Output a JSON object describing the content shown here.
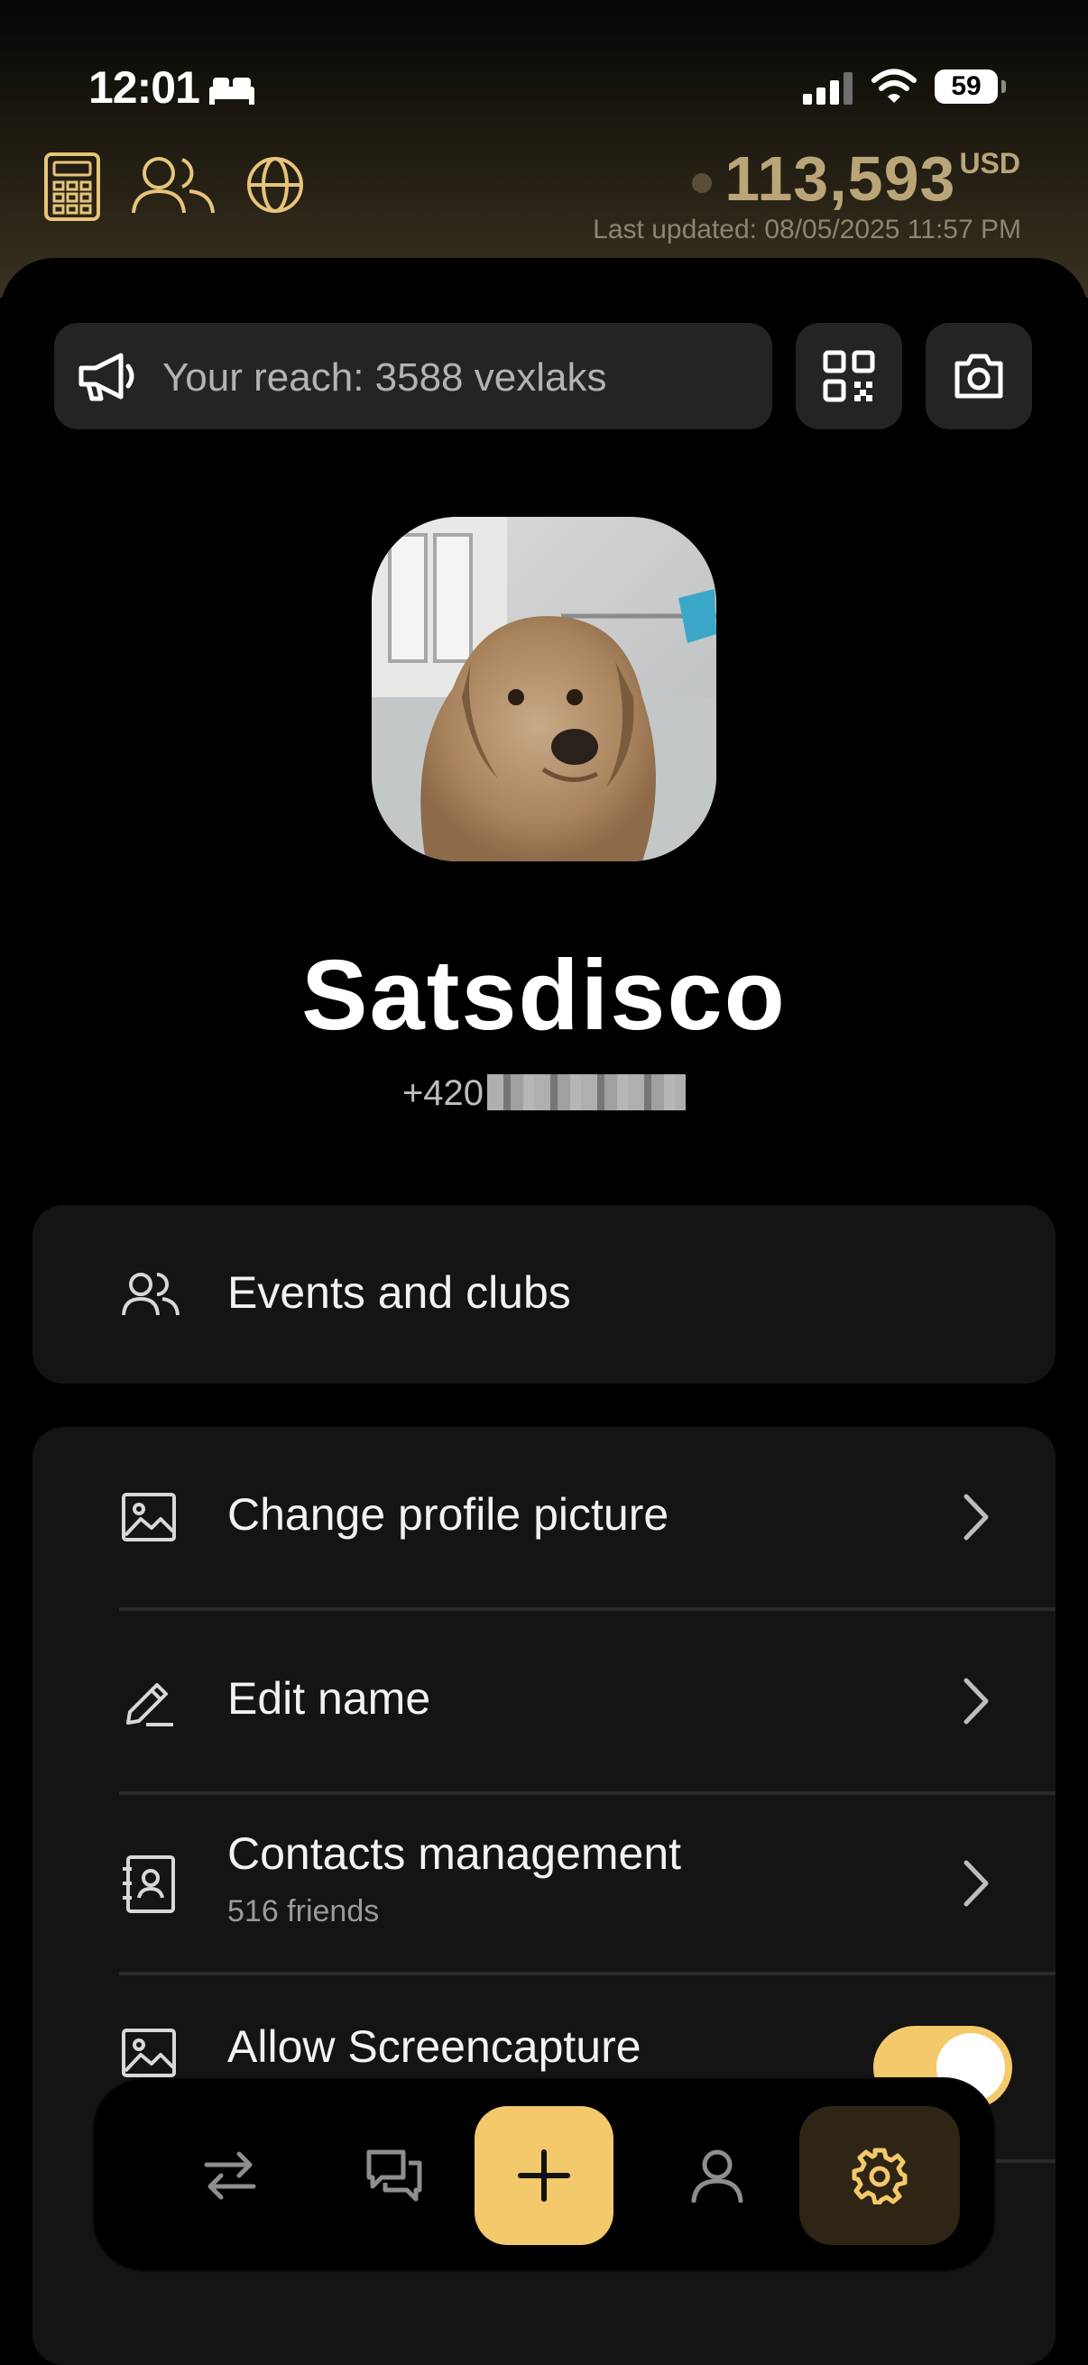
{
  "status_bar": {
    "time": "12:01",
    "battery": "59"
  },
  "header": {
    "balance_value": "113,593",
    "balance_unit": "USD",
    "last_updated": "Last updated: 08/05/2025 11:57 PM"
  },
  "reach": {
    "text": "Your reach: 3588 vexlaks"
  },
  "profile": {
    "name": "Satsdisco",
    "phone_prefix": "+420"
  },
  "menu": {
    "events": "Events and clubs",
    "change_picture": "Change profile picture",
    "edit_name": "Edit name",
    "contacts": "Contacts management",
    "contacts_sub": "516 friends",
    "allow_screencapture": "Allow Screencapture",
    "allow_screencapture_on": true
  },
  "colors": {
    "accent": "#f3c96b",
    "gold_text": "#b9a577",
    "card_bg": "#141414",
    "nav_active_bg": "#2e2515"
  }
}
